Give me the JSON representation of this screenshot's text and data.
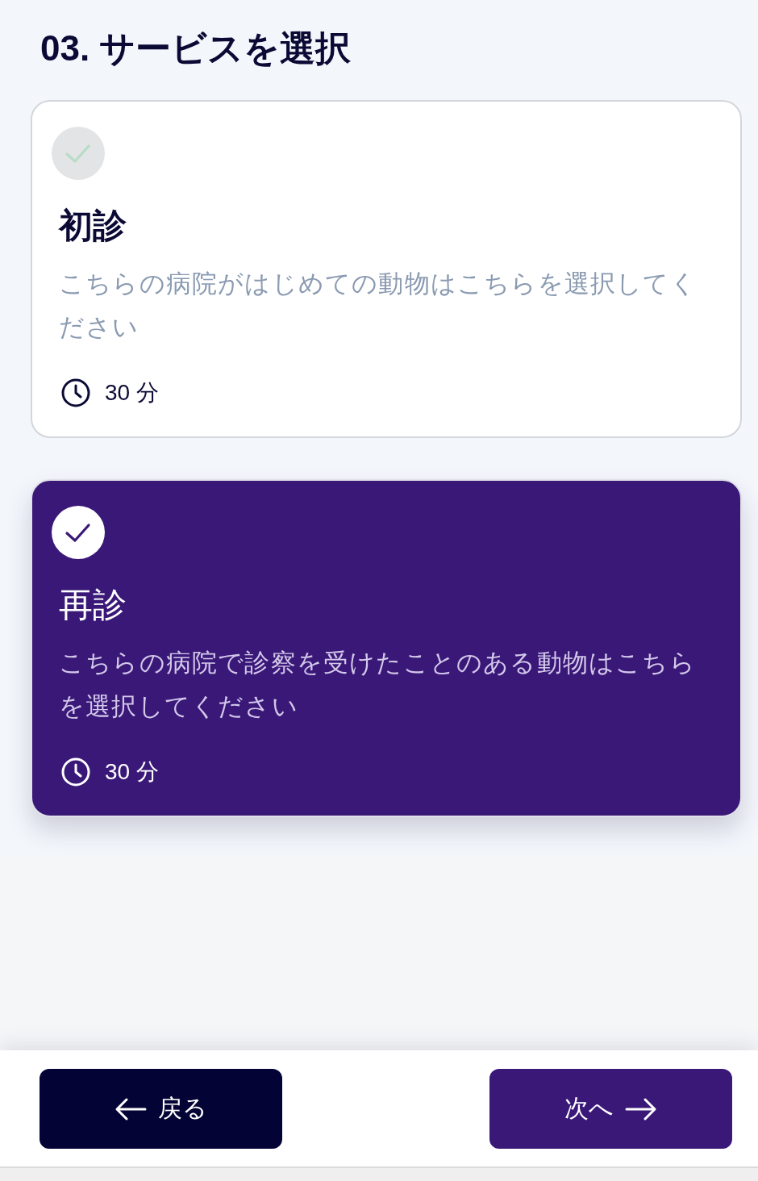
{
  "page": {
    "title": "03. サービスを選択"
  },
  "services": [
    {
      "name": "初診",
      "description": "こちらの病院がはじめての動物はこちらを選択してください",
      "duration": "30 分",
      "selected": false
    },
    {
      "name": "再診",
      "description": "こちらの病院で診察を受けたことのある動物はこちらを選択してください",
      "duration": "30 分",
      "selected": true
    }
  ],
  "footer": {
    "buttons": [
      {
        "kind": "back",
        "label": "戻る"
      },
      {
        "kind": "next",
        "label": "次へ"
      }
    ]
  }
}
